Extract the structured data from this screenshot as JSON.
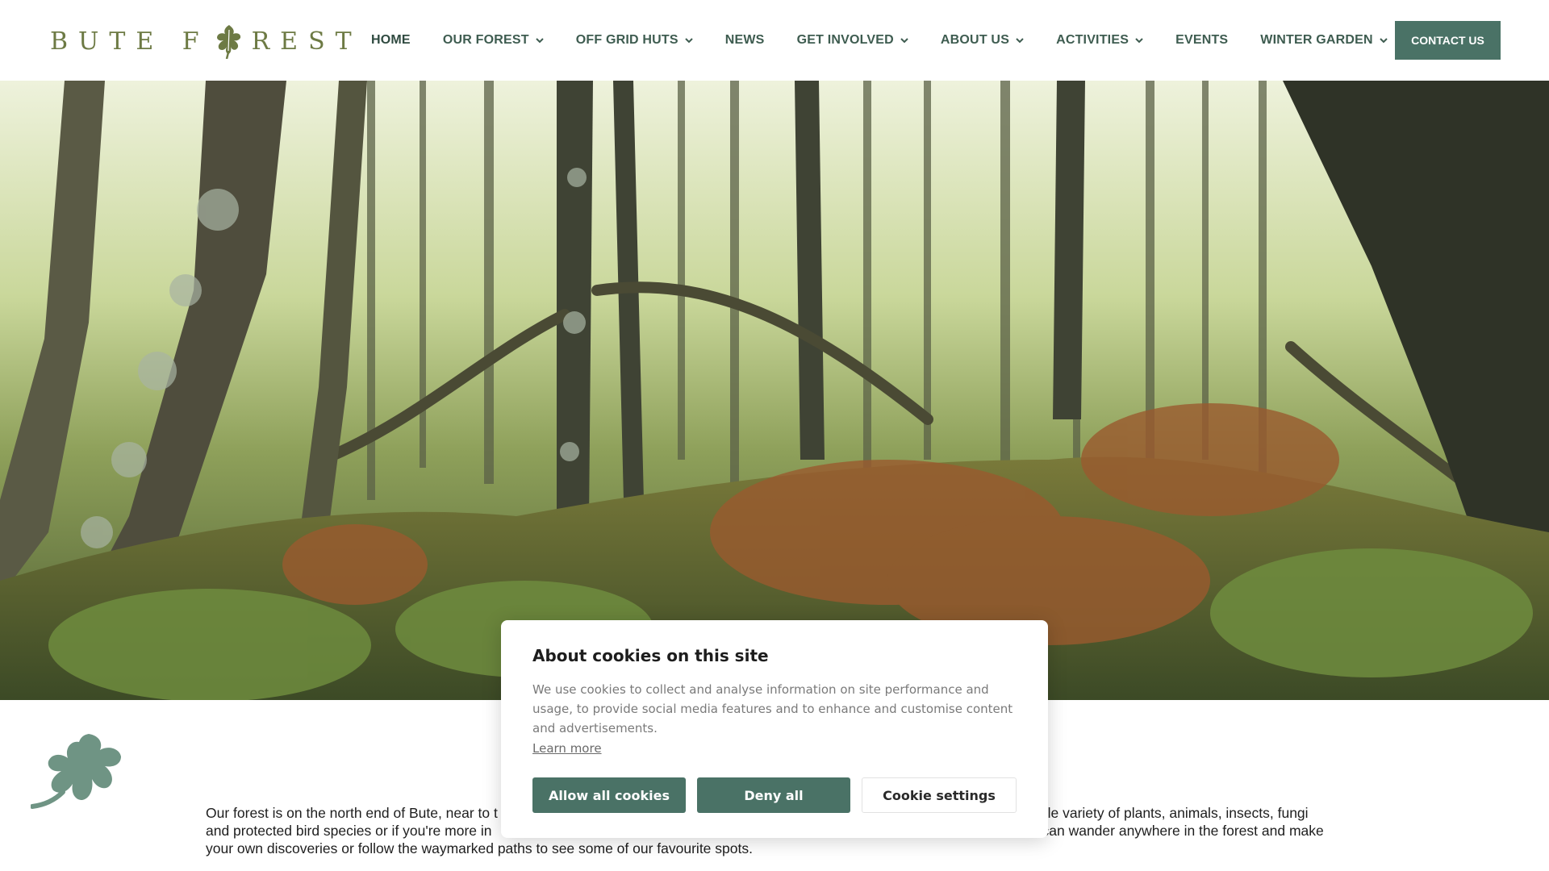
{
  "header": {
    "logo_text_left": "BUTE F",
    "logo_text_right": "REST",
    "nav": [
      {
        "label": "HOME",
        "has_dropdown": false
      },
      {
        "label": "OUR FOREST",
        "has_dropdown": true
      },
      {
        "label": "OFF GRID HUTS",
        "has_dropdown": true
      },
      {
        "label": "NEWS",
        "has_dropdown": false
      },
      {
        "label": "GET INVOLVED",
        "has_dropdown": true
      },
      {
        "label": "ABOUT US",
        "has_dropdown": true
      },
      {
        "label": "ACTIVITIES",
        "has_dropdown": true
      },
      {
        "label": "EVENTS",
        "has_dropdown": false
      },
      {
        "label": "WINTER GARDEN",
        "has_dropdown": true
      }
    ],
    "contact_label": "CONTACT US"
  },
  "hero": {
    "image_icon": "forest-photo"
  },
  "intro": {
    "line1_left": "Our forest is on the north end of Bute, near to t",
    "line1_right": "ole variety of plants, animals, insects, fungi",
    "line2_left": "and protected bird species or if you're more in",
    "line2_right": "can wander anywhere in the forest and make",
    "line3": "your own discoveries or follow the waymarked paths to see some of our favourite spots."
  },
  "cookie": {
    "title": "About cookies on this site",
    "body": "We use cookies to collect and analyse information on site performance and usage, to provide social media features and to enhance and customise content and advertisements.",
    "learn_more": "Learn more",
    "allow_all": "Allow all cookies",
    "deny_all": "Deny all",
    "settings": "Cookie settings"
  },
  "colors": {
    "brand_green": "#4a7266",
    "logo_olive": "#6d7a44",
    "nav_text": "#3e5c50",
    "leaf_decor": "#6f9484"
  }
}
